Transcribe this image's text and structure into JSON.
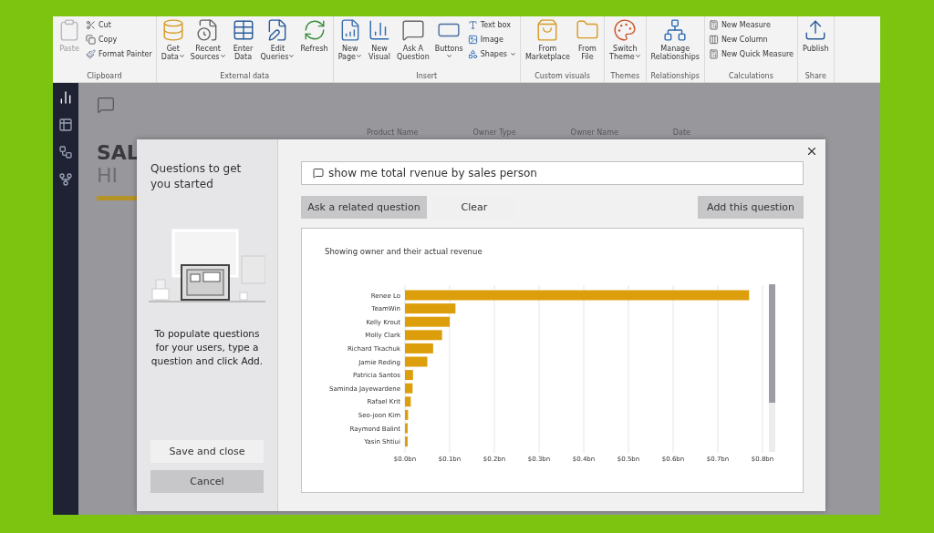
{
  "ribbon": {
    "groups": [
      {
        "label": "Clipboard",
        "items": [
          {
            "kind": "large",
            "lines": [
              "Paste"
            ],
            "disabled": true
          },
          {
            "kind": "small",
            "lines": [
              "Cut"
            ],
            "disabled": false
          },
          {
            "kind": "small",
            "lines": [
              "Copy"
            ],
            "disabled": false
          },
          {
            "kind": "small",
            "lines": [
              "Format Painter"
            ],
            "disabled": false
          }
        ]
      },
      {
        "label": "External data",
        "items": [
          {
            "kind": "large",
            "lines": [
              "Get",
              "Data"
            ],
            "dropdown": true,
            "disabled": false
          },
          {
            "kind": "large",
            "lines": [
              "Recent",
              "Sources"
            ],
            "dropdown": true,
            "disabled": false
          },
          {
            "kind": "large",
            "lines": [
              "Enter",
              "Data"
            ],
            "disabled": false
          },
          {
            "kind": "large",
            "lines": [
              "Edit",
              "Queries"
            ],
            "dropdown": true,
            "disabled": false
          },
          {
            "kind": "large",
            "lines": [
              "Refresh"
            ],
            "disabled": false
          }
        ]
      },
      {
        "label": "Insert",
        "items": [
          {
            "kind": "large",
            "lines": [
              "New",
              "Page"
            ],
            "dropdown": true,
            "disabled": false
          },
          {
            "kind": "large",
            "lines": [
              "New",
              "Visual"
            ],
            "disabled": false
          },
          {
            "kind": "large",
            "lines": [
              "Ask A",
              "Question"
            ],
            "disabled": false
          },
          {
            "kind": "large",
            "lines": [
              "Buttons"
            ],
            "dropdown": true,
            "disabled": false
          },
          {
            "kind": "small",
            "lines": [
              "Text box"
            ],
            "disabled": false
          },
          {
            "kind": "small",
            "lines": [
              "Image"
            ],
            "disabled": false
          },
          {
            "kind": "small",
            "lines": [
              "Shapes"
            ],
            "dropdown": true,
            "disabled": false
          }
        ]
      },
      {
        "label": "Custom visuals",
        "items": [
          {
            "kind": "large",
            "lines": [
              "From",
              "Marketplace"
            ],
            "disabled": false
          },
          {
            "kind": "large",
            "lines": [
              "From",
              "File"
            ],
            "disabled": false
          }
        ]
      },
      {
        "label": "Themes",
        "items": [
          {
            "kind": "large",
            "lines": [
              "Switch",
              "Theme"
            ],
            "dropdown": true,
            "disabled": false
          }
        ]
      },
      {
        "label": "Relationships",
        "items": [
          {
            "kind": "large",
            "lines": [
              "Manage",
              "Relationships"
            ],
            "disabled": false
          }
        ]
      },
      {
        "label": "Calculations",
        "items": [
          {
            "kind": "small",
            "lines": [
              "New Measure"
            ],
            "disabled": false
          },
          {
            "kind": "small",
            "lines": [
              "New Column"
            ],
            "disabled": false
          },
          {
            "kind": "small",
            "lines": [
              "New Quick Measure"
            ],
            "disabled": false
          }
        ]
      },
      {
        "label": "Share",
        "items": [
          {
            "kind": "large",
            "lines": [
              "Publish"
            ],
            "disabled": false
          }
        ]
      }
    ]
  },
  "nav": [
    {
      "selected": true
    },
    {
      "selected": false
    },
    {
      "selected": false
    },
    {
      "selected": false
    }
  ],
  "report": {
    "title": "SAL",
    "subtitle": "HI",
    "filters": [
      "Product Name",
      "Owner Type",
      "Owner Name",
      "Date"
    ]
  },
  "dialog": {
    "sidebar": {
      "title": "Questions to get you started",
      "hint": "To populate questions for your users, type a question and click Add.",
      "buttons": [
        {
          "label": "Save and close",
          "kind": "secondary"
        },
        {
          "label": "Cancel",
          "kind": "primary"
        }
      ]
    },
    "question": {
      "value": "show me total rvenue by sales person"
    },
    "buttons": [
      {
        "label": "Ask a related question",
        "kind": "primary"
      },
      {
        "label": "Clear",
        "kind": "secondary"
      },
      {
        "label": "Add this question",
        "kind": "primary"
      }
    ],
    "result": {
      "chart_data": {
        "type": "bar",
        "orientation": "horizontal",
        "grid": true,
        "title": "Showing owner and their actual revenue",
        "categories": [
          "Renee Lo",
          "TeamWin",
          "Kelly Krout",
          "Molly Clark",
          "Richard Tkachuk",
          "Jamie Reding",
          "Patricia Santos",
          "Saminda Jayewardene",
          "Rafael Krit",
          "Seo-joon Kim",
          "Raymond Balint",
          "Yasin Shtiui"
        ],
        "series": [
          {
            "color": "#dd9e0c",
            "values": [
              0.77,
              0.113,
              0.1,
              0.083,
              0.063,
              0.05,
              0.018,
              0.017,
              0.013,
              0.007,
              0.006,
              0.006
            ]
          }
        ],
        "xlim": [
          0,
          0.8
        ],
        "xticks": [
          {
            "value": 0,
            "label": "$0.0bn"
          },
          {
            "value": 0.1,
            "label": "$0.1bn"
          },
          {
            "value": 0.2,
            "label": "$0.2bn"
          },
          {
            "value": 0.3,
            "label": "$0.3bn"
          },
          {
            "value": 0.4,
            "label": "$0.4bn"
          },
          {
            "value": 0.5,
            "label": "$0.5bn"
          },
          {
            "value": 0.6,
            "label": "$0.6bn"
          },
          {
            "value": 0.7,
            "label": "$0.7bn"
          },
          {
            "value": 0.8,
            "label": "$0.8bn"
          }
        ]
      }
    }
  }
}
